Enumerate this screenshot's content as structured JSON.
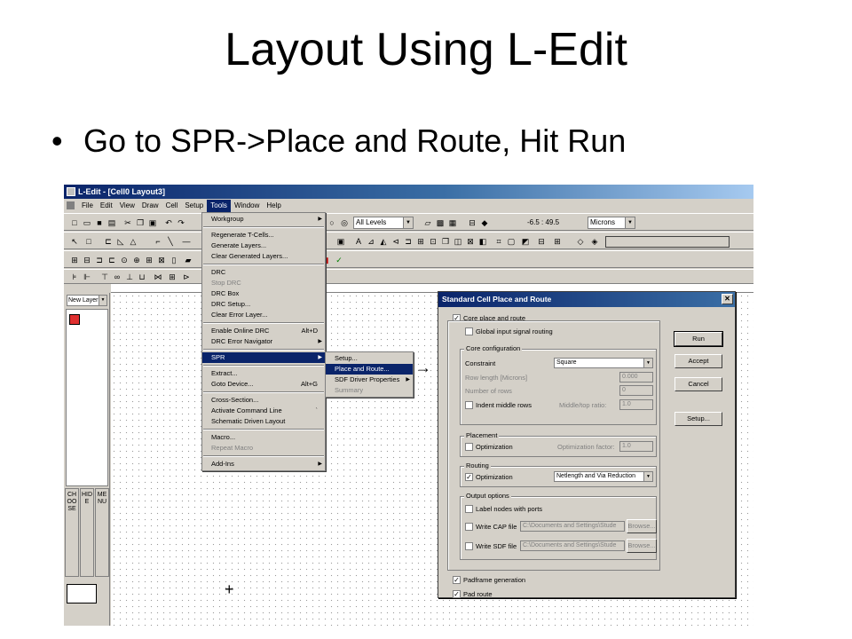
{
  "slide": {
    "title": "Layout Using L-Edit",
    "bullet": "Go to SPR->Place and Route, Hit Run"
  },
  "window": {
    "title": "L-Edit - [Cell0    Layout3]"
  },
  "menubar": [
    "File",
    "Edit",
    "View",
    "Draw",
    "Cell",
    "Setup",
    "Tools",
    "Window",
    "Help"
  ],
  "menubar_active": "Tools",
  "toolbar": {
    "layers_combo": "All Levels",
    "coordinates": "-6.5 : 49.5",
    "units_combo": "Microns"
  },
  "left_panel": {
    "layer_combo": "New Layer",
    "tabs": [
      "CHOOSE",
      "HIDE",
      "MENU"
    ]
  },
  "tools_menu": [
    {
      "label": "Workgroup",
      "submenu": true
    },
    {
      "sep": true
    },
    {
      "label": "Regenerate T-Cells..."
    },
    {
      "label": "Generate Layers..."
    },
    {
      "label": "Clear Generated Layers..."
    },
    {
      "sep": true
    },
    {
      "label": "DRC"
    },
    {
      "label": "Stop DRC",
      "disabled": true
    },
    {
      "label": "DRC Box"
    },
    {
      "label": "DRC Setup..."
    },
    {
      "label": "Clear Error Layer..."
    },
    {
      "sep": true
    },
    {
      "label": "Enable Online DRC",
      "shortcut": "Alt+D"
    },
    {
      "label": "DRC Error Navigator",
      "submenu": true
    },
    {
      "sep": true
    },
    {
      "label": "SPR",
      "submenu": true,
      "highlight": true
    },
    {
      "sep": true
    },
    {
      "label": "Extract..."
    },
    {
      "label": "Goto Device...",
      "shortcut": "Alt+G"
    },
    {
      "sep": true
    },
    {
      "label": "Cross-Section..."
    },
    {
      "label": "Activate Command Line",
      "shortcut": "`"
    },
    {
      "label": "Schematic Driven Layout"
    },
    {
      "sep": true
    },
    {
      "label": "Macro..."
    },
    {
      "label": "Repeat Macro",
      "disabled": true
    },
    {
      "sep": true
    },
    {
      "label": "Add-Ins",
      "submenu": true
    }
  ],
  "spr_menu": [
    {
      "label": "Setup..."
    },
    {
      "label": "Place and Route...",
      "highlight": true
    },
    {
      "label": "SDF Driver Properties",
      "submenu": true
    },
    {
      "label": "Summary",
      "disabled": true
    }
  ],
  "callout_arrow": "→",
  "dialog": {
    "title": "Standard Cell Place and Route",
    "close": "✕",
    "core_place_route": {
      "label": "Core place and route",
      "checked": true
    },
    "global_routing": {
      "label": "Global input signal routing",
      "checked": false
    },
    "core_config": {
      "group": "Core configuration",
      "constraint_label": "Constraint",
      "constraint_value": "Square",
      "row_length_label": "Row length   [Microns]",
      "row_length_value": "0.000",
      "num_rows_label": "Number of rows",
      "num_rows_value": "0",
      "indent_label": "Indent middle rows",
      "indent_checked": false,
      "ratio_label": "Middle/top ratio:",
      "ratio_value": "1.0"
    },
    "placement": {
      "group": "Placement",
      "opt_label": "Optimization",
      "opt_checked": false,
      "factor_label": "Optimization factor:",
      "factor_value": "1.0"
    },
    "routing": {
      "group": "Routing",
      "opt_label": "Optimization",
      "opt_checked": true,
      "method": "Netlength and Via Reduction"
    },
    "output": {
      "group": "Output options",
      "label_nodes": "Label nodes with ports",
      "cap_label": "Write CAP file",
      "cap_path": "C:\\Documents and Settings\\Stude",
      "sdf_label": "Write SDF file",
      "sdf_path": "C:\\Documents and Settings\\Stude",
      "browse": "Browse..."
    },
    "padframe": {
      "label": "Padframe generation",
      "checked": true
    },
    "padroute": {
      "label": "Pad route",
      "checked": true
    },
    "buttons": {
      "run": "Run",
      "accept": "Accept",
      "cancel": "Cancel",
      "setup": "Setup..."
    }
  }
}
